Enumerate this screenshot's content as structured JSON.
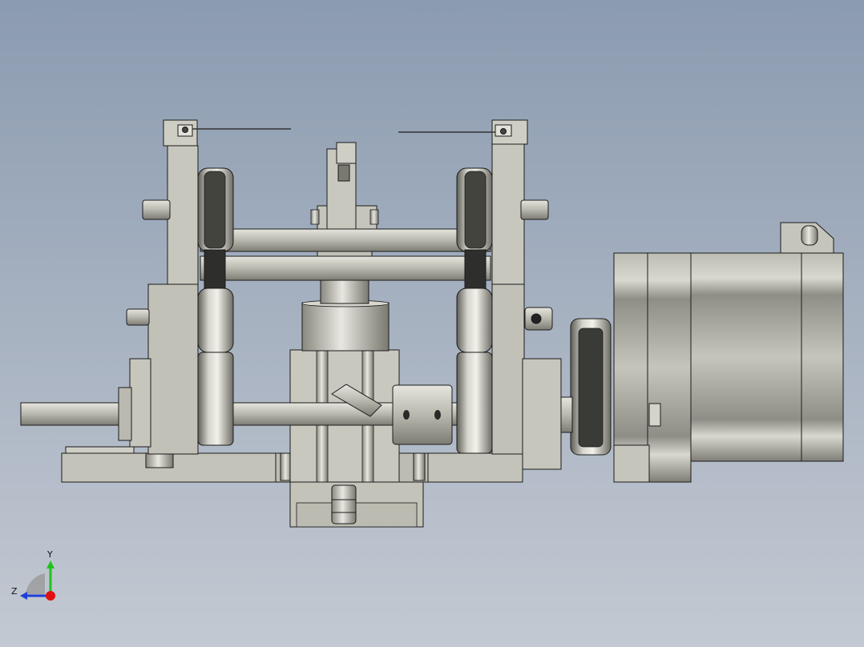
{
  "viewport": {
    "background_top": "#8b9bb0",
    "background_bottom": "#c3c9d2",
    "model_name": "",
    "model_style": "shaded-with-edges",
    "part_colors": {
      "metal_light": "#c9c8bf",
      "metal_mid": "#a9a89e",
      "metal_dark": "#6a6a62",
      "belt": "#2e2e2c",
      "edge": "#1b1b1b"
    }
  },
  "triad": {
    "y_label": "Y",
    "z_label": "Z",
    "y_color": "#1ec41e",
    "z_color": "#1f3fd6",
    "x_color": "#e01010"
  }
}
